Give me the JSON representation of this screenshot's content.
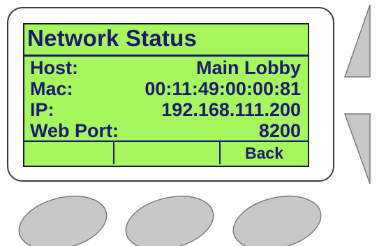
{
  "screen": {
    "title": "Network Status",
    "rows": [
      {
        "label": "Host:",
        "value": "Main Lobby"
      },
      {
        "label": "Mac:",
        "value": "00:11:49:00:00:81"
      },
      {
        "label": "IP:",
        "value": "192.168.111.200"
      },
      {
        "label": "Web Port:",
        "value": "8200"
      }
    ],
    "softkeys": [
      "",
      "",
      "Back"
    ]
  },
  "colors": {
    "lcd_background": "#a6f65e",
    "lcd_text": "#1c1a6e",
    "button_fill": "#c8c8c8",
    "button_stroke": "#7a7a7a"
  },
  "icons": {
    "up_button": "up-arrow-icon",
    "down_button": "down-arrow-icon",
    "soft_buttons": "oval-button"
  }
}
